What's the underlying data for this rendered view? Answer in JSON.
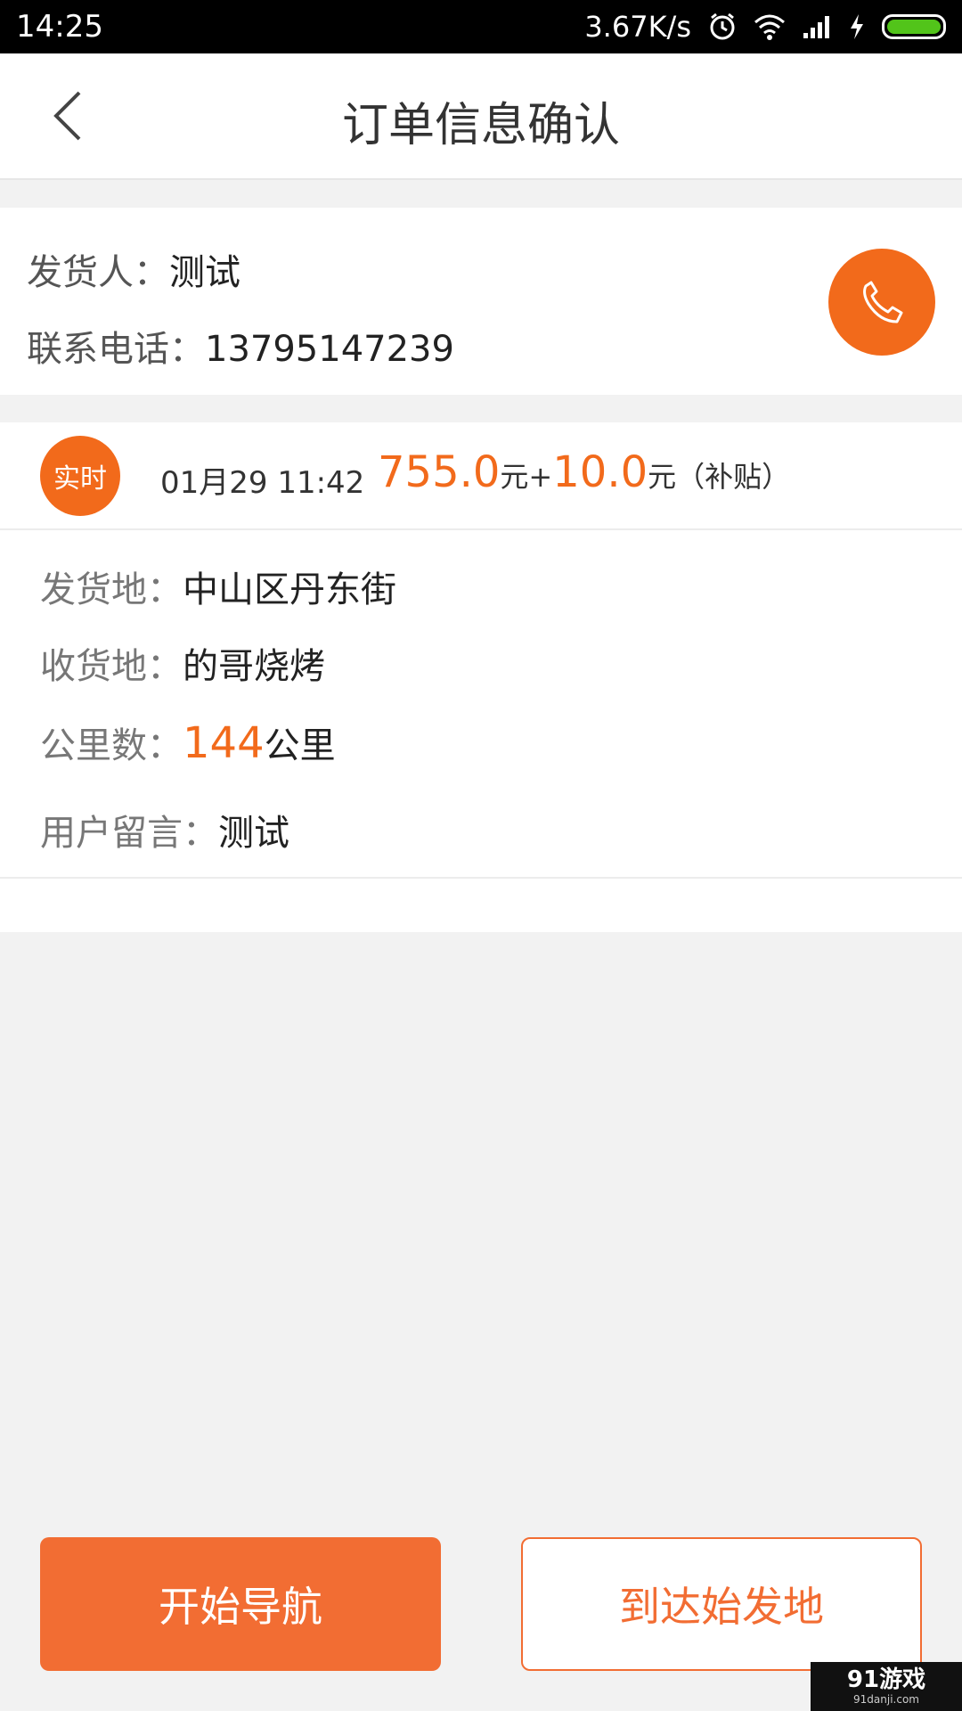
{
  "status_bar": {
    "time": "14:25",
    "speed": "3.67K/s",
    "icons": [
      "alarm-icon",
      "wifi-icon",
      "signal-icon",
      "charging-icon",
      "battery-icon"
    ],
    "battery_color": "#52c41a"
  },
  "header": {
    "title": "订单信息确认",
    "back_icon": "chevron-left-icon"
  },
  "sender": {
    "name_label": "发货人：",
    "name_value": "测试",
    "phone_label": "联系电话：",
    "phone_value": "13795147239",
    "call_icon": "phone-icon"
  },
  "order": {
    "badge": "实时",
    "time": "01月29 11:42",
    "price": "755.0",
    "price_unit": "元+",
    "subsidy": "10.0",
    "subsidy_unit": "元（补贴）",
    "from_label": "发货地：",
    "from_value": "中山区丹东街",
    "to_label": "收货地：",
    "to_value": "的哥烧烤",
    "distance_label": "公里数：",
    "distance_value": "144",
    "distance_unit": "公里",
    "note_label": "用户留言：",
    "note_value": "测试"
  },
  "actions": {
    "start_nav": "开始导航",
    "arrive_origin": "到达始发地"
  },
  "watermark": {
    "main": "91游戏",
    "sub": "91danji.com"
  },
  "colors": {
    "accent": "#f26a1b",
    "background": "#f2f2f2"
  }
}
